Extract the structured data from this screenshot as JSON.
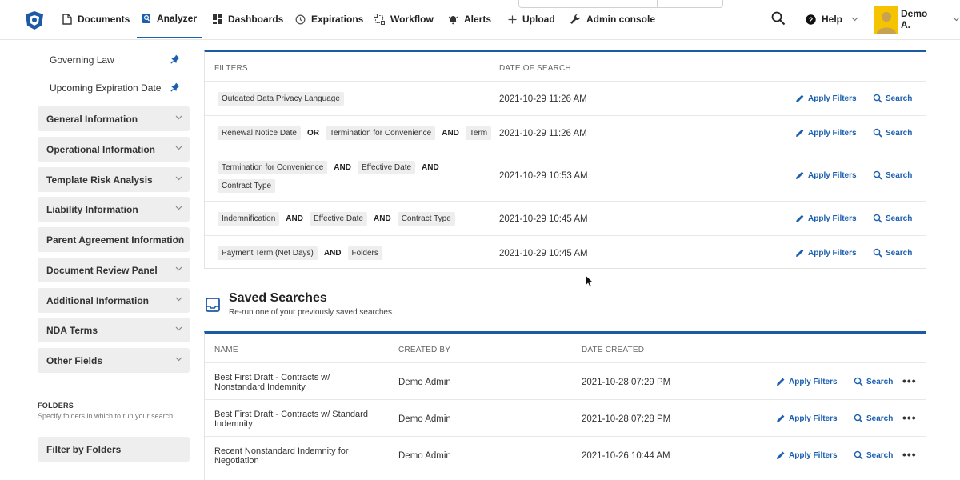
{
  "nav": {
    "items": [
      {
        "label": "Documents",
        "icon": "document-icon"
      },
      {
        "label": "Analyzer",
        "icon": "analyzer-icon",
        "active": true
      },
      {
        "label": "Dashboards",
        "icon": "dashboard-icon"
      },
      {
        "label": "Expirations",
        "icon": "clock-icon"
      },
      {
        "label": "Workflow",
        "icon": "workflow-icon"
      },
      {
        "label": "Alerts",
        "icon": "alert-icon"
      },
      {
        "label": "Upload",
        "icon": "plus-icon"
      },
      {
        "label": "Admin console",
        "icon": "wrench-icon"
      }
    ],
    "help_label": "Help",
    "user_name": "Demo A."
  },
  "sidebar": {
    "pinned": [
      {
        "label": "Governing Law"
      },
      {
        "label": "Upcoming Expiration Date"
      }
    ],
    "sections": [
      "General Information",
      "Operational Information",
      "Template Risk Analysis",
      "Liability Information",
      "Parent Agreement Information",
      "Document Review Panel",
      "Additional Information",
      "NDA Terms",
      "Other Fields"
    ],
    "folders": {
      "title": "FOLDERS",
      "description": "Specify folders in which to run your search.",
      "button_label": "Filter by Folders"
    }
  },
  "recent_searches": {
    "columns": {
      "filters": "FILTERS",
      "date": "DATE OF SEARCH"
    },
    "apply_label": "Apply Filters",
    "search_label": "Search",
    "rows": [
      {
        "filters": [
          {
            "tag": "Outdated Data Privacy Language"
          }
        ],
        "date": "2021-10-29 11:26 AM"
      },
      {
        "filters": [
          {
            "tag": "Renewal Notice Date"
          },
          {
            "op": "OR"
          },
          {
            "tag": "Termination for Convenience"
          },
          {
            "op": "AND"
          },
          {
            "tag": "Term"
          }
        ],
        "date": "2021-10-29 11:26 AM"
      },
      {
        "filters": [
          {
            "tag": "Termination for Convenience"
          },
          {
            "op": "AND"
          },
          {
            "tag": "Effective Date"
          },
          {
            "op": "AND"
          },
          {
            "tag": "Contract Type"
          }
        ],
        "date": "2021-10-29 10:53 AM"
      },
      {
        "filters": [
          {
            "tag": "Indemnification"
          },
          {
            "op": "AND"
          },
          {
            "tag": "Effective Date"
          },
          {
            "op": "AND"
          },
          {
            "tag": "Contract Type"
          }
        ],
        "date": "2021-10-29 10:45 AM"
      },
      {
        "filters": [
          {
            "tag": "Payment Term (Net Days)"
          },
          {
            "op": "AND"
          },
          {
            "tag": "Folders"
          }
        ],
        "date": "2021-10-29 10:45 AM"
      }
    ]
  },
  "saved_searches": {
    "title": "Saved Searches",
    "subtitle": "Re-run one of your previously saved searches.",
    "columns": {
      "name": "NAME",
      "created_by": "CREATED BY",
      "date_created": "DATE CREATED"
    },
    "apply_label": "Apply Filters",
    "search_label": "Search",
    "more_label": "•••",
    "rows": [
      {
        "name": "Best First Draft - Contracts w/ Nonstandard Indemnity",
        "created_by": "Demo Admin",
        "date": "2021-10-28 07:29 PM"
      },
      {
        "name": "Best First Draft - Contracts w/ Standard Indemnity",
        "created_by": "Demo Admin",
        "date": "2021-10-28 07:28 PM"
      },
      {
        "name": "Recent Nonstandard Indemnity for Negotiation",
        "created_by": "Demo Admin",
        "date": "2021-10-26 10:44 AM"
      }
    ]
  },
  "colors": {
    "accent": "#1b5fb0",
    "panel_border": "#1d5aa6",
    "avatar": "#f5c300"
  }
}
